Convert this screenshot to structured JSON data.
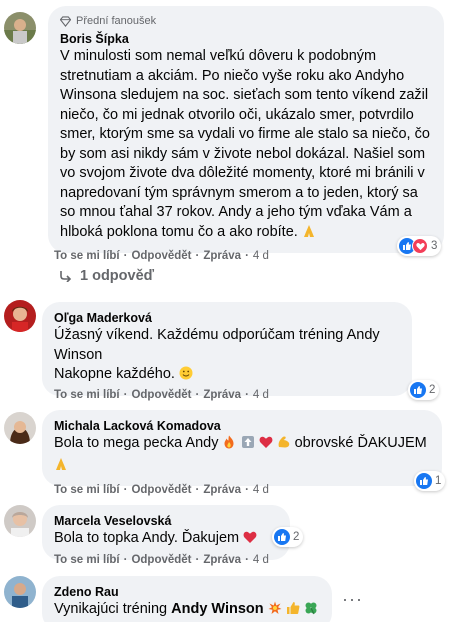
{
  "comments": [
    {
      "badge": "Přední fanoušek",
      "author": "Boris Šípka",
      "text": "V minulosti som nemal veľkú dôveru k podobným stretnutiam a akciám. Po niečo vyše roku ako Andyho Winsona sledujem na soc. sieťach som tento víkend zažil niečo, čo mi jednak otvorilo oči, ukázalo smer, potvrdilo smer, ktorým sme sa vydali vo firme ale stalo sa niečo, čo by som asi nikdy sám v živote nebol dokázal. Našiel som vo svojom živote dva dôležité momenty, ktoré mi bránili v napredovaní tým správnym smerom a to jeden, ktorý sa so mnou ťahal 37 rokov. Andy a jeho tým vďaka Vám a hlboká poklona tomu čo a ako robíte.",
      "like": "To se mi líbí",
      "reply": "Odpovědět",
      "share": "Zpráva",
      "time": "4 d",
      "reaction_count": "3",
      "reactions": [
        "like-icon",
        "love-icon"
      ]
    },
    {
      "author": "Oľga Maderková",
      "text_line1": "Úžasný víkend. Každému odporúčam tréning Andy Winson",
      "text_line2": "Nakopne každého.",
      "like": "To se mi líbí",
      "reply": "Odpovědět",
      "share": "Zpráva",
      "time": "4 d",
      "reaction_count": "2",
      "reactions": [
        "like-icon"
      ]
    },
    {
      "author": "Michala Lacková Komadova",
      "text_before": "Bola to mega pecka Andy",
      "text_after": "obrovské ĎAKUJEM",
      "like": "To se mi líbí",
      "reply": "Odpovědět",
      "share": "Zpráva",
      "time": "4 d",
      "reaction_count": "1",
      "reactions": [
        "like-icon"
      ]
    },
    {
      "author": "Marcela Veselovská",
      "text": "Bola to topka Andy. Ďakujem",
      "like": "To se mi líbí",
      "reply": "Odpovědět",
      "share": "Zpráva",
      "time": "4 d",
      "reaction_count": "2",
      "reactions": [
        "like-icon"
      ]
    },
    {
      "author": "Zdeno Rau",
      "text_before": "Vynikajúci tréning",
      "text_strong": "Andy Winson",
      "more": "···"
    }
  ],
  "replies_label": "1 odpověď",
  "colors": {
    "bubble": "#f0f2f5",
    "meta": "#65676b",
    "like": "#1877f2",
    "love": "#f33e58"
  }
}
